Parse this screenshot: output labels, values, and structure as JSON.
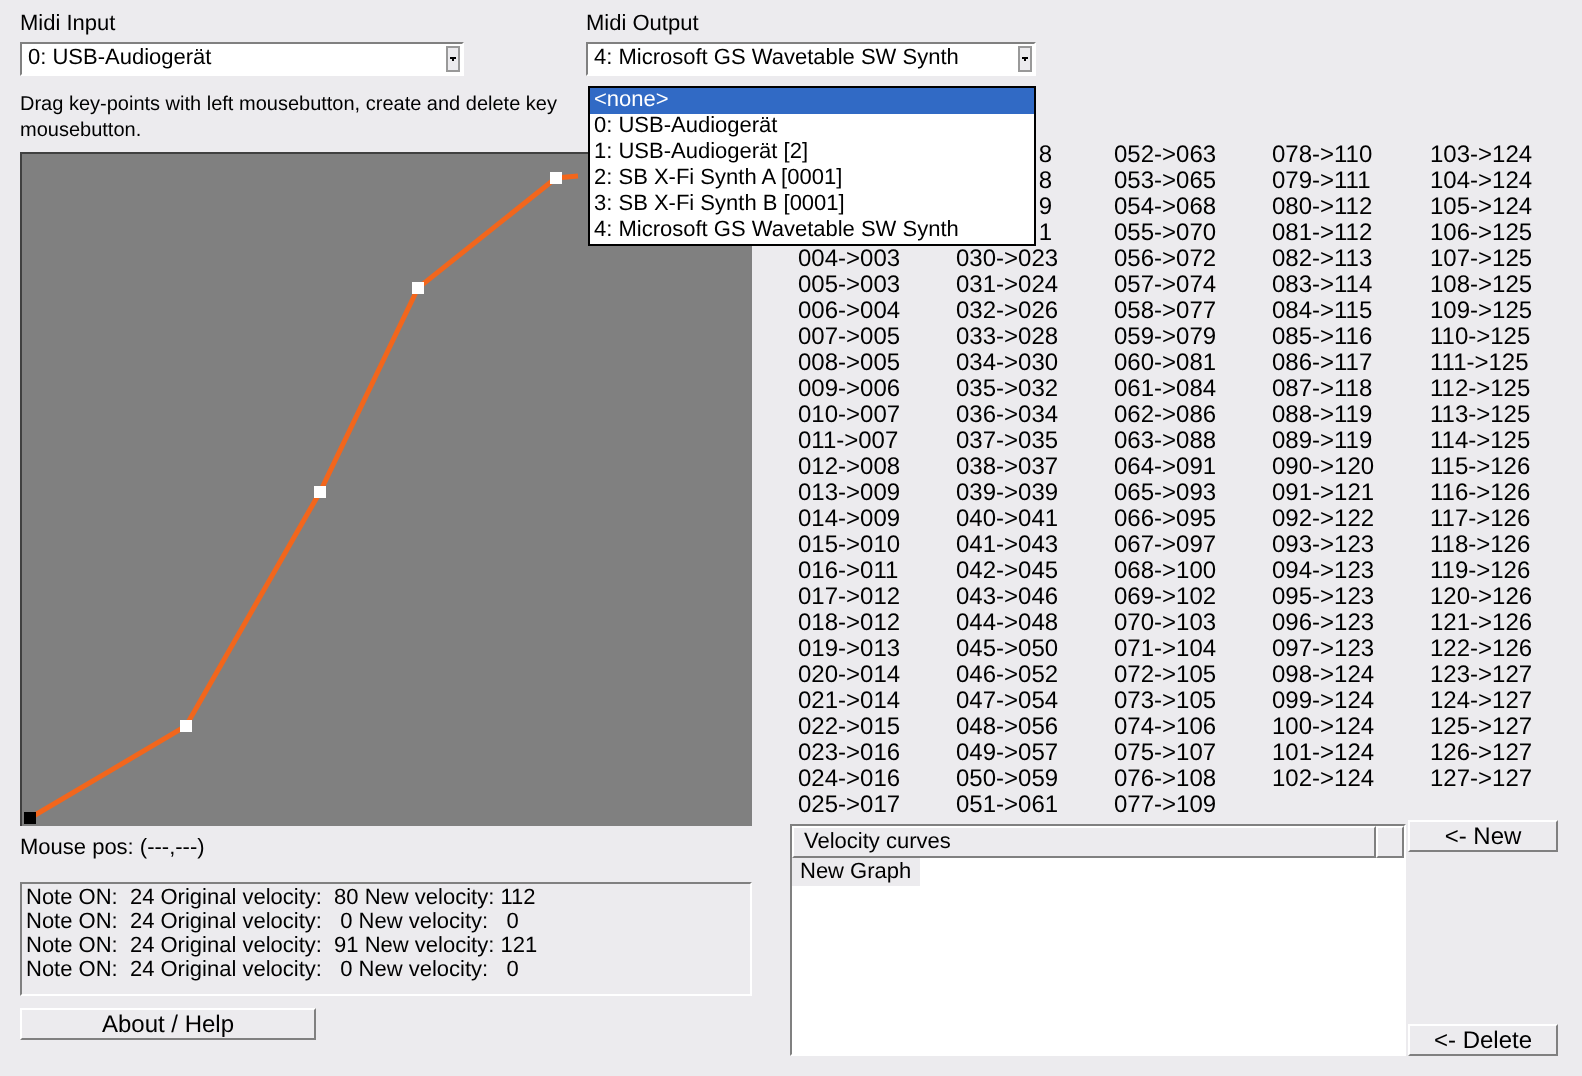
{
  "midi_input": {
    "label": "Midi Input",
    "value": "0: USB-Audiogerät"
  },
  "midi_output": {
    "label": "Midi Output",
    "value": "4: Microsoft GS Wavetable SW Synth",
    "expanded": true,
    "options": [
      {
        "label": "<none>",
        "highlighted": true
      },
      {
        "label": "0: USB-Audiogerät",
        "highlighted": false
      },
      {
        "label": "1: USB-Audiogerät [2]",
        "highlighted": false
      },
      {
        "label": "2: SB X-Fi Synth A [0001]",
        "highlighted": false
      },
      {
        "label": "3: SB X-Fi Synth B [0001]",
        "highlighted": false
      },
      {
        "label": "4: Microsoft GS Wavetable SW Synth",
        "highlighted": false
      }
    ]
  },
  "instructions": [
    "Drag key-points with left mousebutton, create and delete key",
    "mousebutton."
  ],
  "mapping_table": {
    "columns": [
      {
        "cells": [
          "004->003",
          "005->003",
          "006->004",
          "007->005",
          "008->005",
          "009->006",
          "010->007",
          "011->007",
          "012->008",
          "013->009",
          "014->009",
          "015->010",
          "016->011",
          "017->012",
          "018->012",
          "019->013",
          "020->014",
          "021->014",
          "022->015",
          "023->016",
          "024->016",
          "025->017"
        ]
      },
      {
        "fragments": [
          "8",
          "8",
          "9",
          "1"
        ],
        "cells": [
          "030->023",
          "031->024",
          "032->026",
          "033->028",
          "034->030",
          "035->032",
          "036->034",
          "037->035",
          "038->037",
          "039->039",
          "040->041",
          "041->043",
          "042->045",
          "043->046",
          "044->048",
          "045->050",
          "046->052",
          "047->054",
          "048->056",
          "049->057",
          "050->059",
          "051->061"
        ]
      },
      {
        "cells": [
          "052->063",
          "053->065",
          "054->068",
          "055->070",
          "056->072",
          "057->074",
          "058->077",
          "059->079",
          "060->081",
          "061->084",
          "062->086",
          "063->088",
          "064->091",
          "065->093",
          "066->095",
          "067->097",
          "068->100",
          "069->102",
          "070->103",
          "071->104",
          "072->105",
          "073->105",
          "074->106",
          "075->107",
          "076->108",
          "077->109"
        ]
      },
      {
        "cells": [
          "078->110",
          "079->111",
          "080->112",
          "081->112",
          "082->113",
          "083->114",
          "084->115",
          "085->116",
          "086->117",
          "087->118",
          "088->119",
          "089->119",
          "090->120",
          "091->121",
          "092->122",
          "093->123",
          "094->123",
          "095->123",
          "096->123",
          "097->123",
          "098->124",
          "099->124",
          "100->124",
          "101->124",
          "102->124"
        ]
      },
      {
        "cells": [
          "103->124",
          "104->124",
          "105->124",
          "106->125",
          "107->125",
          "108->125",
          "109->125",
          "110->125",
          "111->125",
          "112->125",
          "113->125",
          "114->125",
          "115->126",
          "116->126",
          "117->126",
          "118->126",
          "119->126",
          "120->126",
          "121->126",
          "122->126",
          "123->127",
          "124->127",
          "125->127",
          "126->127",
          "127->127"
        ]
      }
    ]
  },
  "mouse_pos": "Mouse pos: (---,---)",
  "log": [
    "Note ON:  24 Original velocity:  80 New velocity: 112",
    "Note ON:  24 Original velocity:   0 New velocity:   0",
    "Note ON:  24 Original velocity:  91 New velocity: 121",
    "Note ON:  24 Original velocity:   0 New velocity:   0"
  ],
  "about_button": "About / Help",
  "velocity_curves": {
    "header": "Velocity curves",
    "items": [
      {
        "label": "New Graph",
        "selected": true
      }
    ]
  },
  "new_button": "<- New",
  "delete_button": "<- Delete"
}
